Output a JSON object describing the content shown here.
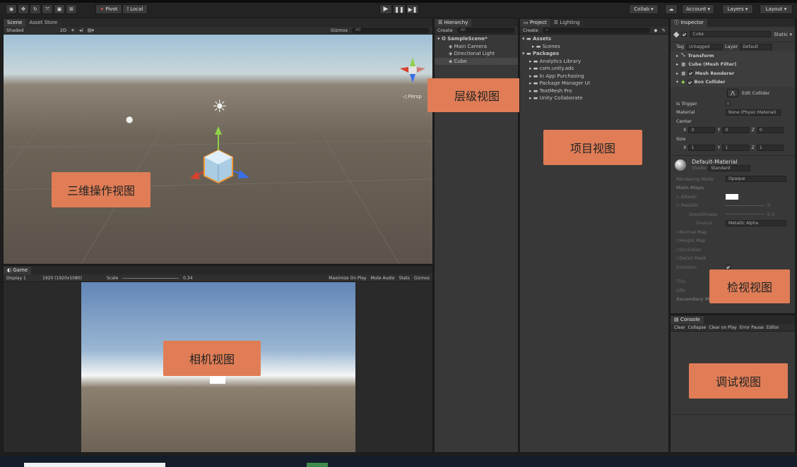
{
  "toolbar": {
    "pivot_label": "Pivot",
    "local_label": "Local",
    "collab_label": "Collab ▾",
    "account_label": "Account",
    "layers_label": "Layers",
    "layout_label": "Layout"
  },
  "scene": {
    "tabs": [
      "Scene",
      "Asset Store"
    ],
    "shading": "Shaded",
    "mode_2d": "2D",
    "gizmos": "Gizmos",
    "search_placeholder": "All",
    "persp_label": "Persp",
    "overlay_label": "三维操作视图"
  },
  "game": {
    "tab": "Game",
    "display": "Display 1",
    "resolution": "1920 (1920x1080)",
    "scale_label": "Scale",
    "scale_value": "0.34",
    "maximize": "Maximize On Play",
    "mute": "Mute Audio",
    "stats": "Stats",
    "gizmos": "Gizmos",
    "overlay_label": "相机视图"
  },
  "hierarchy": {
    "tab": "Hierarchy",
    "create": "Create",
    "search_placeholder": "All",
    "scene_name": "SampleScene*",
    "items": [
      "Main Camera",
      "Directional Light",
      "Cube"
    ],
    "overlay_label": "层级视图"
  },
  "project": {
    "tabs": [
      "Project",
      "Lighting"
    ],
    "create": "Create",
    "assets_label": "Assets",
    "scenes_label": "Scenes",
    "packages_label": "Packages",
    "packages": [
      "Analytics Library",
      "com.unity.ads",
      "In App Purchasing",
      "Package Manager UI",
      "TextMesh Pro",
      "Unity Collaborate"
    ],
    "overlay_label": "项目视图"
  },
  "inspector": {
    "tab": "Inspector",
    "object_name": "Cube",
    "static_label": "Static",
    "tag_label": "Tag",
    "tag_value": "Untagged",
    "layer_label": "Layer",
    "layer_value": "Default",
    "components": [
      "Transform",
      "Cube (Mesh Filter)",
      "Mesh Renderer",
      "Box Collider"
    ],
    "edit_collider": "Edit Collider",
    "is_trigger": "Is Trigger",
    "material_label": "Material",
    "material_value": "None (Physic Material)",
    "center_label": "Center",
    "center": {
      "x": "0",
      "y": "0",
      "z": "0"
    },
    "size_label": "Size",
    "size": {
      "x": "1",
      "y": "1",
      "z": "1"
    },
    "default_material": "Default-Material",
    "shader_label": "Shader",
    "shader_value": "Standard",
    "rendering_mode_label": "Rendering Mode",
    "rendering_mode_value": "Opaque",
    "main_maps": "Main Maps",
    "albedo": "Albedo",
    "metallic": "Metallic",
    "metallic_value": "0",
    "smoothness": "Smoothness",
    "smoothness_value": "0.5",
    "source": "Source",
    "source_value": "Metallic Alpha",
    "normal_map": "Normal Map",
    "height_map": "Height Map",
    "occlusion": "Occlusion",
    "detail_mask": "Detail Mask",
    "emission": "Emission",
    "tiling": "Tilin",
    "offset": "Offs",
    "secondary_maps": "Secondary Maps",
    "overlay_label": "检视视图"
  },
  "console": {
    "tab": "Console",
    "buttons": [
      "Clear",
      "Collapse",
      "Clear on Play",
      "Error Pause",
      "Editor"
    ],
    "overlay_label": "调试视图"
  },
  "colors": {
    "accent": "#e07d56",
    "panel": "#383838",
    "dark": "#232323"
  }
}
